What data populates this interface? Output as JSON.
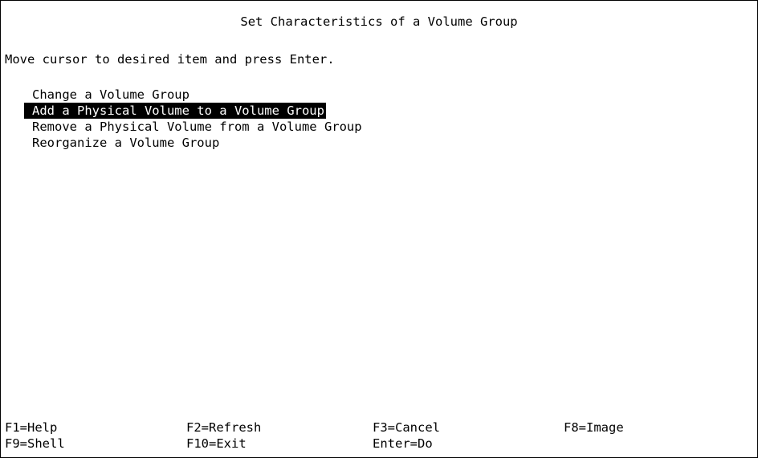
{
  "screen": {
    "title": "Set Characteristics of a Volume Group",
    "instruction": "Move cursor to desired item and press Enter."
  },
  "menu": {
    "selected_index": 1,
    "items": [
      {
        "label": "Change a Volume Group"
      },
      {
        "label": "Add a Physical Volume to a Volume Group"
      },
      {
        "label": "Remove a Physical Volume from a Volume Group"
      },
      {
        "label": "Reorganize a Volume Group"
      }
    ]
  },
  "function_keys": {
    "row1": [
      {
        "label": "F1=Help"
      },
      {
        "label": "F2=Refresh"
      },
      {
        "label": "F3=Cancel"
      },
      {
        "label": "F8=Image"
      }
    ],
    "row2": [
      {
        "label": "F9=Shell"
      },
      {
        "label": "F10=Exit"
      },
      {
        "label": "Enter=Do"
      }
    ]
  },
  "colors": {
    "background": "#ffffff",
    "foreground": "#000000",
    "highlight_background": "#000000",
    "highlight_foreground": "#ffffff"
  }
}
